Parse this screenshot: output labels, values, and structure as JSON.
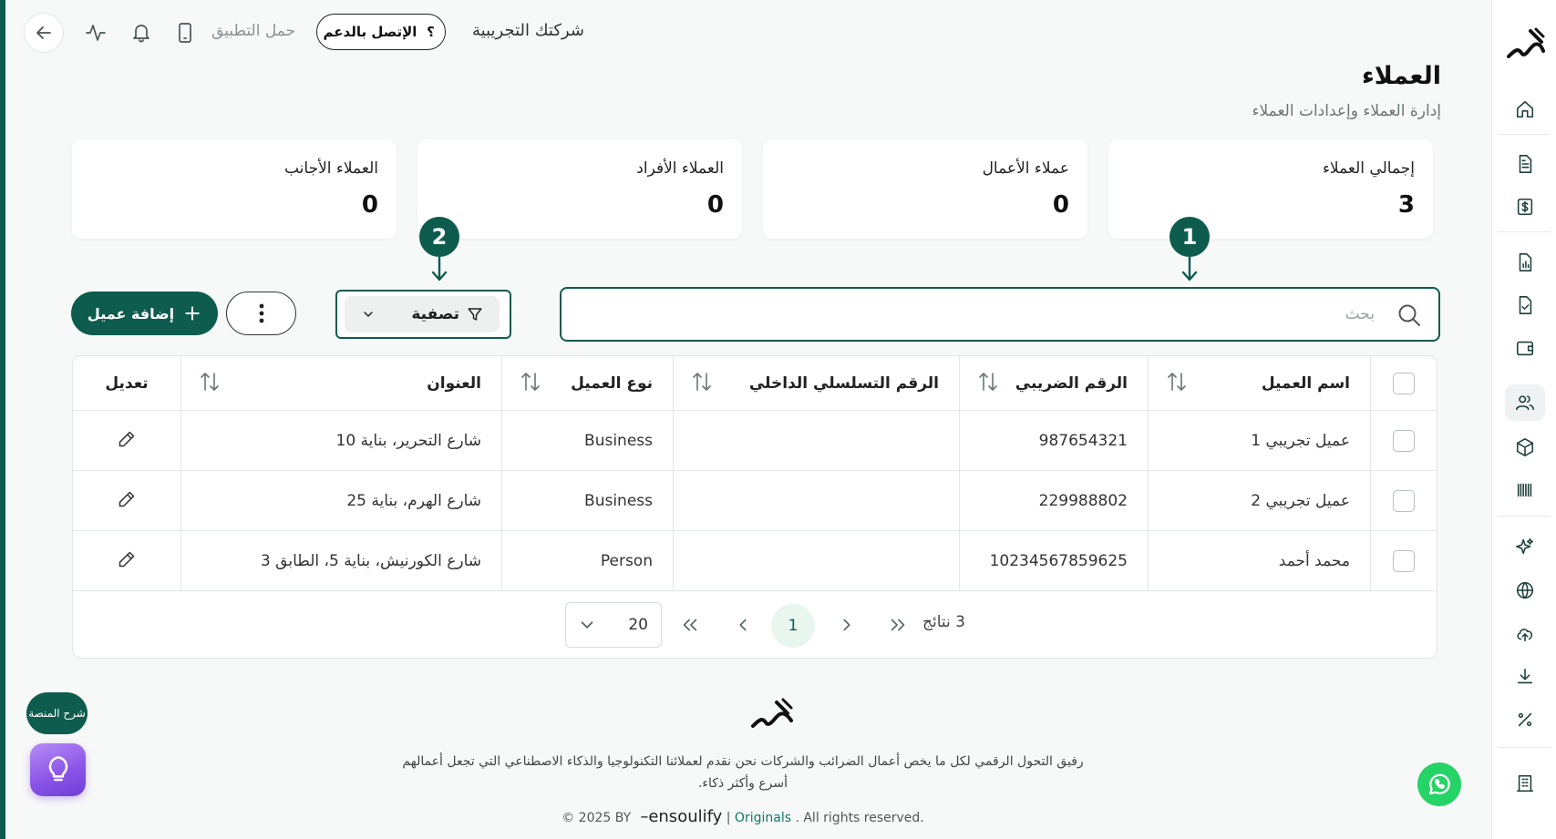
{
  "header": {
    "company": "شركتك التجريبية",
    "support_label": "الإتصل بالدعم",
    "app_link": "حمل التطبيق"
  },
  "page": {
    "title": "العملاء",
    "subtitle": "إدارة العملاء وإعدادات العملاء"
  },
  "stats": [
    {
      "label": "إجمالي العملاء",
      "value": "3"
    },
    {
      "label": "عملاء الأعمال",
      "value": "0"
    },
    {
      "label": "العملاء الأفراد",
      "value": "0"
    },
    {
      "label": "العملاء الأجانب",
      "value": "0"
    }
  ],
  "markers": [
    "1",
    "2"
  ],
  "search": {
    "placeholder": "بحث",
    "value": ""
  },
  "toolbar": {
    "filter_label": "تصفية",
    "add_label": "إضافة عميل"
  },
  "table": {
    "headers": {
      "name": "اسم العميل",
      "tax_number": "الرقم الضريبي",
      "serial": "الرقم التسلسلي الداخلي",
      "type": "نوع العميل",
      "address": "العنوان",
      "edit": "تعديل"
    },
    "rows": [
      {
        "name": "عميل تجريبي 1",
        "tax_number": "987654321",
        "serial": "",
        "type": "Business",
        "address": "شارع التحرير، بناية 10"
      },
      {
        "name": "عميل تجريبي 2",
        "tax_number": "229988802",
        "serial": "",
        "type": "Business",
        "address": "شارع الهرم، بناية 25"
      },
      {
        "name": "محمد أحمد",
        "tax_number": "10234567859625",
        "serial": "",
        "type": "Person",
        "address": "شارع الكورنيش، بناية 5، الطابق 3"
      }
    ]
  },
  "pagination": {
    "results": "3 نتائج",
    "current_page": "1",
    "page_size": "20"
  },
  "footer": {
    "description": "رفيق التحول الرقمي لكل ما يخص أعمال الضرائب والشركات نحن نقدم لعملائنا التكنولوجيا والذكاء الاصطناعي التي تجعل أعمالهم أسرع وأكثر ذكاء.",
    "copyright_prefix": "© 2025 BY",
    "brand": "ensoulify",
    "originals": "Originals",
    "rights": ". All rights reserved."
  },
  "floating": {
    "explain_label": "شرح المنصة"
  },
  "colors": {
    "primary": "#0d5c4d",
    "accent_light": "#e8f6ef",
    "idea_gradient": "#8a52e8",
    "whatsapp": "#25d366"
  }
}
